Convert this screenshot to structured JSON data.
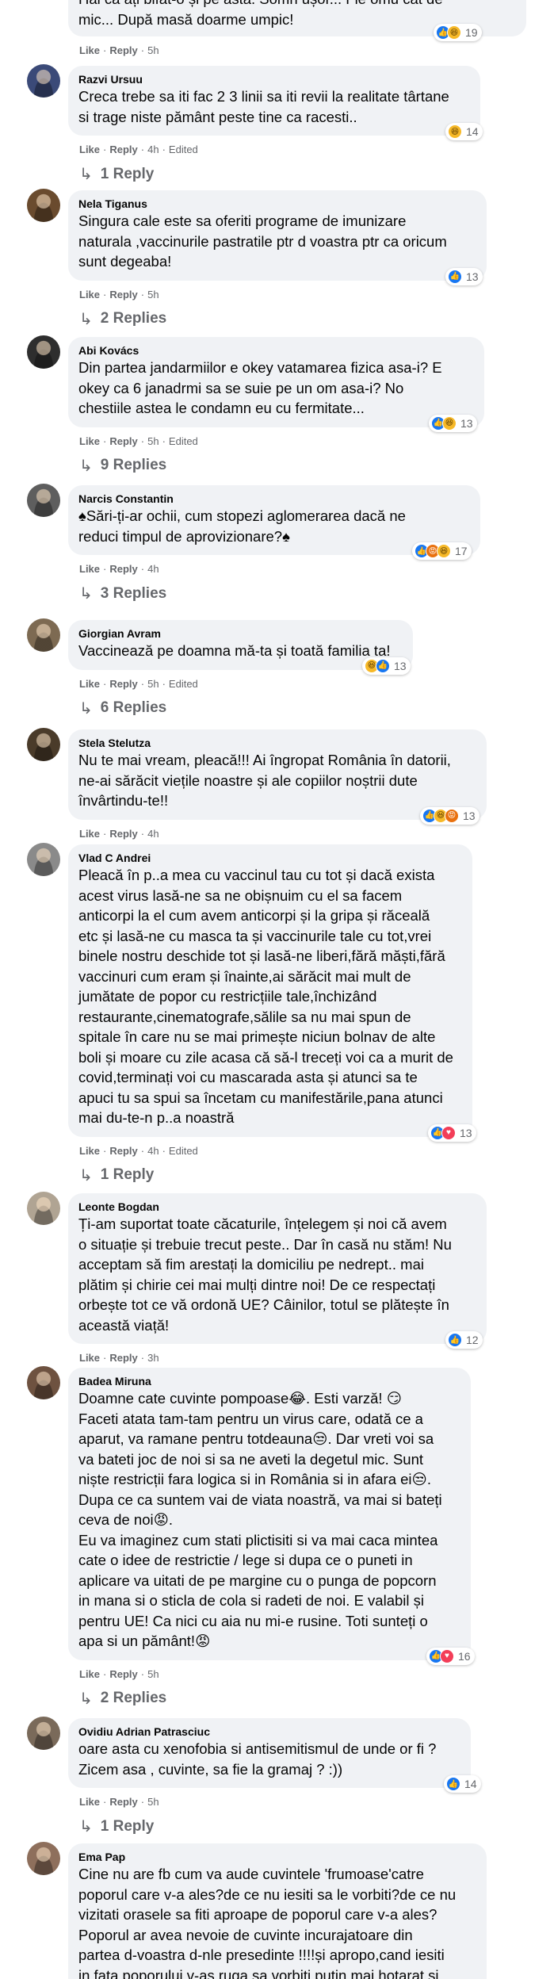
{
  "comments": [
    {
      "name": "",
      "lines": [
        "Hai că ați bifat-o și pe asta. Somn ușor... Fie omu cât de",
        "mic... După masă doarme umpic!"
      ],
      "time": "5h",
      "edited": "",
      "reactions": [
        "like",
        "haha"
      ],
      "count": "19",
      "replies": ""
    },
    {
      "name": "Razvi Ursuu",
      "lines": [
        "Creca trebe sa iti fac 2 3 linii sa iti revii la realitate târtane",
        "si trage niste pământ peste tine ca racesti.."
      ],
      "time": "4h",
      "edited": "Edited",
      "reactions": [
        "haha"
      ],
      "count": "14",
      "replies": "1 Reply"
    },
    {
      "name": "Nela Tiganus",
      "lines": [
        "Singura cale este sa oferiti programe de imunizare",
        "naturala ,vaccinurile pastratile ptr d voastra ptr ca oricum",
        "sunt degeaba!"
      ],
      "time": "5h",
      "edited": "",
      "reactions": [
        "like"
      ],
      "count": "13",
      "replies": "2 Replies"
    },
    {
      "name": "Abi Kovács",
      "lines": [
        "Din partea jandarmiilor e okey vatamarea fizica asa-i? E",
        "okey ca 6 janadrmi sa se suie pe un om asa-i? No",
        "chestiile astea le condamn eu cu fermitate..."
      ],
      "time": "5h",
      "edited": "Edited",
      "reactions": [
        "like",
        "haha"
      ],
      "count": "13",
      "replies": "9 Replies"
    },
    {
      "name": "Narcis Constantin",
      "lines": [
        "♠Sări-ți-ar ochii, cum stopezi aglomerarea dacă ne",
        "reduci timpul de aprovizionare?♠"
      ],
      "time": "4h",
      "edited": "",
      "reactions": [
        "like",
        "angry",
        "haha"
      ],
      "count": "17",
      "replies": "3 Replies"
    },
    {
      "name": "Giorgian Avram",
      "lines": [
        "Vaccinează pe doamna mă-ta și toată familia ta!"
      ],
      "time": "5h",
      "edited": "Edited",
      "reactions": [
        "haha",
        "like"
      ],
      "count": "13",
      "replies": "6 Replies"
    },
    {
      "name": "Stela Stelutza",
      "lines": [
        "Nu te mai vream, pleacă!!! Ai îngropat România în datorii,",
        "ne-ai sărăcit viețile noastre și ale copiilor noștrii dute",
        "învârtindu-te!!"
      ],
      "time": "4h",
      "edited": "",
      "reactions": [
        "like",
        "haha",
        "angry"
      ],
      "count": "13",
      "replies": ""
    },
    {
      "name": "Vlad C Andrei",
      "lines": [
        "Pleacă în p..a mea cu vaccinul tau cu tot și dacă exista",
        "acest virus lasă-ne sa ne obișnuim cu el sa facem",
        "anticorpi la el cum avem anticorpi și la gripa și răceală",
        "etc și lasă-ne cu masca ta și vaccinurile tale cu tot,vrei",
        "binele nostru deschide tot și lasă-ne liberi,fără măști,fără",
        "vaccinuri cum eram și înainte,ai sărăcit mai mult de",
        "jumătate de popor cu restricțiile tale,închizând",
        "restaurante,cinematografe,sălile sa nu mai spun de",
        "spitale în care nu se mai primește niciun bolnav de alte",
        "boli și moare cu zile acasa că să-l treceți voi ca a murit de",
        "covid,terminați voi cu mascarada asta și atunci sa te",
        "apuci tu sa spui sa încetam cu manifestările,pana atunci",
        "mai du-te-n p..a noastră"
      ],
      "time": "4h",
      "edited": "Edited",
      "reactions": [
        "like",
        "love"
      ],
      "count": "13",
      "replies": "1 Reply"
    },
    {
      "name": "Leonte Bogdan",
      "lines": [
        "Ți-am suportat toate căcaturile, înțelegem și noi că avem",
        "o situație și trebuie trecut peste.. Dar în casă nu stăm! Nu",
        "acceptam să fim arestați la domiciliu pe nedrept.. mai",
        "plătim și chirie cei mai mulți dintre noi! De ce respectați",
        "orbește tot ce vă ordonă UE? Câinilor, totul se plătește în",
        "această viață!"
      ],
      "time": "3h",
      "edited": "",
      "reactions": [
        "like"
      ],
      "count": "12",
      "replies": ""
    },
    {
      "name": "Badea Miruna",
      "lines": [
        "Doamne cate cuvinte pompoase😂. Esti varză! 😏",
        "Faceti atata tam-tam pentru un virus care, odată ce a",
        "aparut, va ramane pentru totdeauna😒. Dar vreti voi sa",
        "va bateti joc de noi si sa ne aveti la degetul mic. Sunt",
        "niște restricții fara logica si in România si in afara ei😒.",
        "Dupa ce ca suntem vai de viata noastră, va mai si bateți",
        "ceva de noi😡.",
        "Eu va imaginez cum stati plictisiti si va mai caca mintea",
        "cate o idee de restrictie / lege si dupa ce o puneti in",
        "aplicare va uitati de pe margine cu o punga de popcorn",
        "in mana si o sticla de cola si radeti de noi. E valabil și",
        "pentru UE! Ca nici cu aia nu mi-e rusine. Toti sunteți o",
        "apa si un pământ!😡"
      ],
      "time": "5h",
      "edited": "",
      "reactions": [
        "like",
        "love"
      ],
      "count": "16",
      "replies": "2 Replies"
    },
    {
      "name": "Ovidiu Adrian Patrasciuc",
      "lines": [
        "oare asta cu xenofobia si antisemitismul de unde or fi ?",
        "Zicem asa , cuvinte, sa fie la gramaj ? :))"
      ],
      "time": "5h",
      "edited": "",
      "reactions": [
        "like"
      ],
      "count": "14",
      "replies": "1 Reply"
    },
    {
      "name": "Ema Pap",
      "lines": [
        "Cine nu are fb cum va aude cuvintele 'frumoase'catre",
        "poporul care v-a ales?de ce nu iesiti sa le vorbiti?de ce nu",
        "vizitati orasele sa fiti aproape de poporul care v-a ales?",
        "Poporul ar avea nevoie de cuvinte incurajatoare din",
        "partea d-voastra d-nle presedinte !!!!și apropo,cand iesiti",
        "in fata poporului v-as ruga sa vorbiti putin mai hotarat si"
      ],
      "time": "",
      "edited": "",
      "reactions": [],
      "count": "",
      "replies": ""
    }
  ],
  "labels": {
    "like": "Like",
    "reply": "Reply"
  },
  "colors": {
    "bubble": "#f0f2f5",
    "meta": "#65676b",
    "like": "#1877f2",
    "love": "#f33e58",
    "haha": "#f7b928",
    "angry": "#e9710f"
  }
}
